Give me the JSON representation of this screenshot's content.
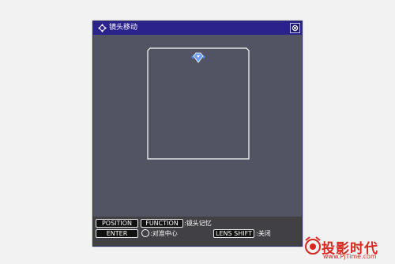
{
  "window": {
    "title": "镜头移动",
    "title_icon": "lens-shift-icon",
    "close_icon": "close-icon"
  },
  "footer": {
    "row1": {
      "key1": "POSITION",
      "key2": "FUNCTION",
      "text": ":镜头记忆"
    },
    "row2": {
      "key1": "ENTER",
      "text1": ":对准中心",
      "key2": "LENS SHIFT",
      "text2": ":关闭"
    }
  },
  "watermark": {
    "name": "投影时代",
    "url": "www.PjTime.com"
  },
  "colors": {
    "titlebar": "#2a238c",
    "panel": "#535463",
    "footer": "#404045",
    "brand": "#d9271f"
  }
}
